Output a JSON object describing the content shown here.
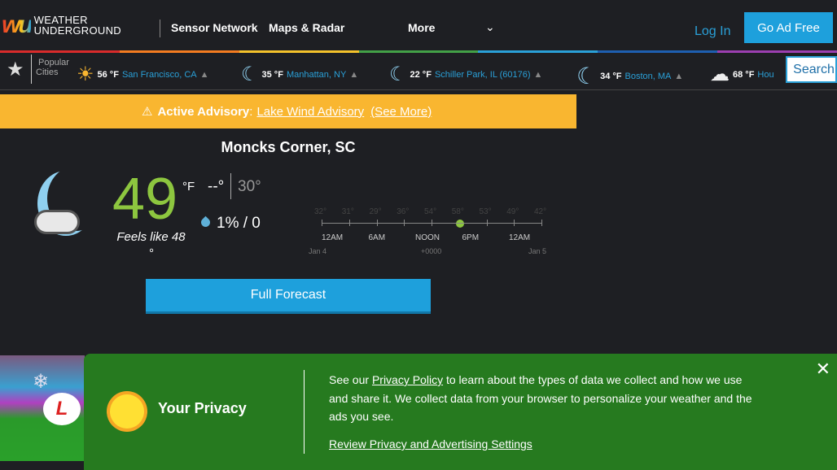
{
  "header": {
    "logo_mark": "wu",
    "logo_text_1": "WEATHER",
    "logo_text_2": "UNDERGROUND",
    "nav": [
      "Sensor Network",
      "Maps & Radar",
      "More"
    ],
    "login": "Log In",
    "ad_free": "Go Ad Free"
  },
  "stripe_colors": [
    "#d92b2b",
    "#f47c20",
    "#f4c22b",
    "#43a047",
    "#2aa0d8",
    "#1e5fb0",
    "#9c3fb0"
  ],
  "popular": {
    "label_1": "Popular",
    "label_2": "Cities",
    "cities": [
      {
        "temp": "56 °F",
        "name": "San Francisco, CA",
        "icon": "sunny-cloud-icon"
      },
      {
        "temp": "35 °F",
        "name": "Manhattan, NY",
        "icon": "moon-cloud-icon"
      },
      {
        "temp": "22 °F",
        "name": "Schiller Park, IL (60176)",
        "icon": "moon-cloud-icon"
      },
      {
        "temp": "34 °F",
        "name": "Boston, MA",
        "icon": "moon-icon"
      },
      {
        "temp": "68 °F",
        "name": "Hou",
        "icon": "cloud-icon"
      }
    ],
    "search": "Search"
  },
  "advisory": {
    "label": "Active Advisory",
    "sep": ":",
    "name": "Lake Wind Advisory",
    "more": "(See More)"
  },
  "current": {
    "location": "Moncks Corner, SC",
    "temp": "49",
    "unit": "°F",
    "feels": "Feels like 48",
    "feels_deg": "°",
    "high": "--°",
    "low": "30°",
    "precip": "1% / 0"
  },
  "timeline": {
    "temps": [
      "32°",
      "31°",
      "29°",
      "36°",
      "54°",
      "58°",
      "53°",
      "49°",
      "42°"
    ],
    "ticks": [
      "12AM",
      "6AM",
      "NOON",
      "6PM",
      "12AM"
    ],
    "date_start": "Jan 4",
    "tz": "+0000",
    "date_end": "Jan 5",
    "current_index": 5
  },
  "full_forecast": "Full Forecast",
  "privacy": {
    "title": "Your Privacy",
    "pre": "See our ",
    "link": "Privacy Policy",
    "post": " to learn about the types of data we collect and how we use and share it. We collect data from your browser to personalize your weather and the ads you see.",
    "review": "Review Privacy and Advertising Settings",
    "close": "✕"
  }
}
